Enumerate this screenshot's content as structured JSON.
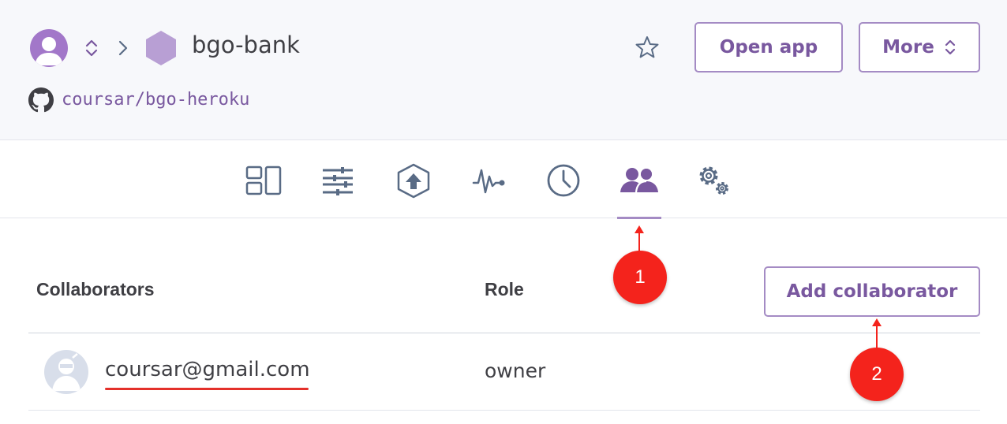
{
  "header": {
    "app_name": "bgo-bank",
    "repo": "coursar/bgo-heroku",
    "open_app_label": "Open app",
    "more_label": "More"
  },
  "nav": {
    "tabs": [
      {
        "icon": "overview-icon"
      },
      {
        "icon": "resources-icon"
      },
      {
        "icon": "deploy-icon"
      },
      {
        "icon": "metrics-icon"
      },
      {
        "icon": "activity-icon"
      },
      {
        "icon": "access-icon",
        "active": true
      },
      {
        "icon": "settings-icon"
      }
    ]
  },
  "table": {
    "col_collaborators": "Collaborators",
    "col_role": "Role",
    "add_label": "Add collaborator",
    "rows": [
      {
        "email": "coursar@gmail.com",
        "role": "owner"
      }
    ]
  },
  "annotations": {
    "marker_1": "1",
    "marker_2": "2"
  },
  "colors": {
    "accent": "#79589f",
    "accent_border": "#a48bc4",
    "annotation": "#f4231c",
    "icon_gray": "#596b85"
  }
}
